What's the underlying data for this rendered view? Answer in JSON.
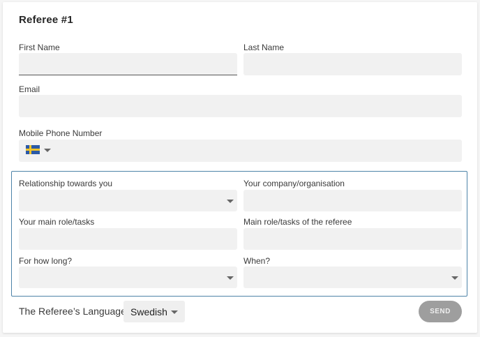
{
  "form": {
    "title": "Referee #1",
    "first_name": {
      "label": "First Name",
      "value": ""
    },
    "last_name": {
      "label": "Last Name",
      "value": ""
    },
    "email": {
      "label": "Email",
      "value": ""
    },
    "mobile": {
      "label": "Mobile Phone Number",
      "country_flag": "sweden-flag-icon",
      "value": ""
    }
  },
  "relationship_section": {
    "relationship": {
      "label": "Relationship towards you",
      "selected": ""
    },
    "company": {
      "label": "Your company/organisation",
      "value": ""
    },
    "your_role": {
      "label": "Your main role/tasks",
      "value": ""
    },
    "referee_role": {
      "label": "Main role/tasks of the referee",
      "value": ""
    },
    "duration": {
      "label": "For how long?",
      "selected": ""
    },
    "when": {
      "label": "When?",
      "selected": ""
    },
    "border_color": "#4d83a8"
  },
  "footer": {
    "language_label": "The Referee’s Language",
    "language_value": "Swedish",
    "send_label": "SEND"
  },
  "colors": {
    "field_bg": "#f1f1f1",
    "send_bg": "#9e9e9e",
    "flag_blue": "#2b5aa7",
    "flag_yellow": "#f4c42a"
  }
}
